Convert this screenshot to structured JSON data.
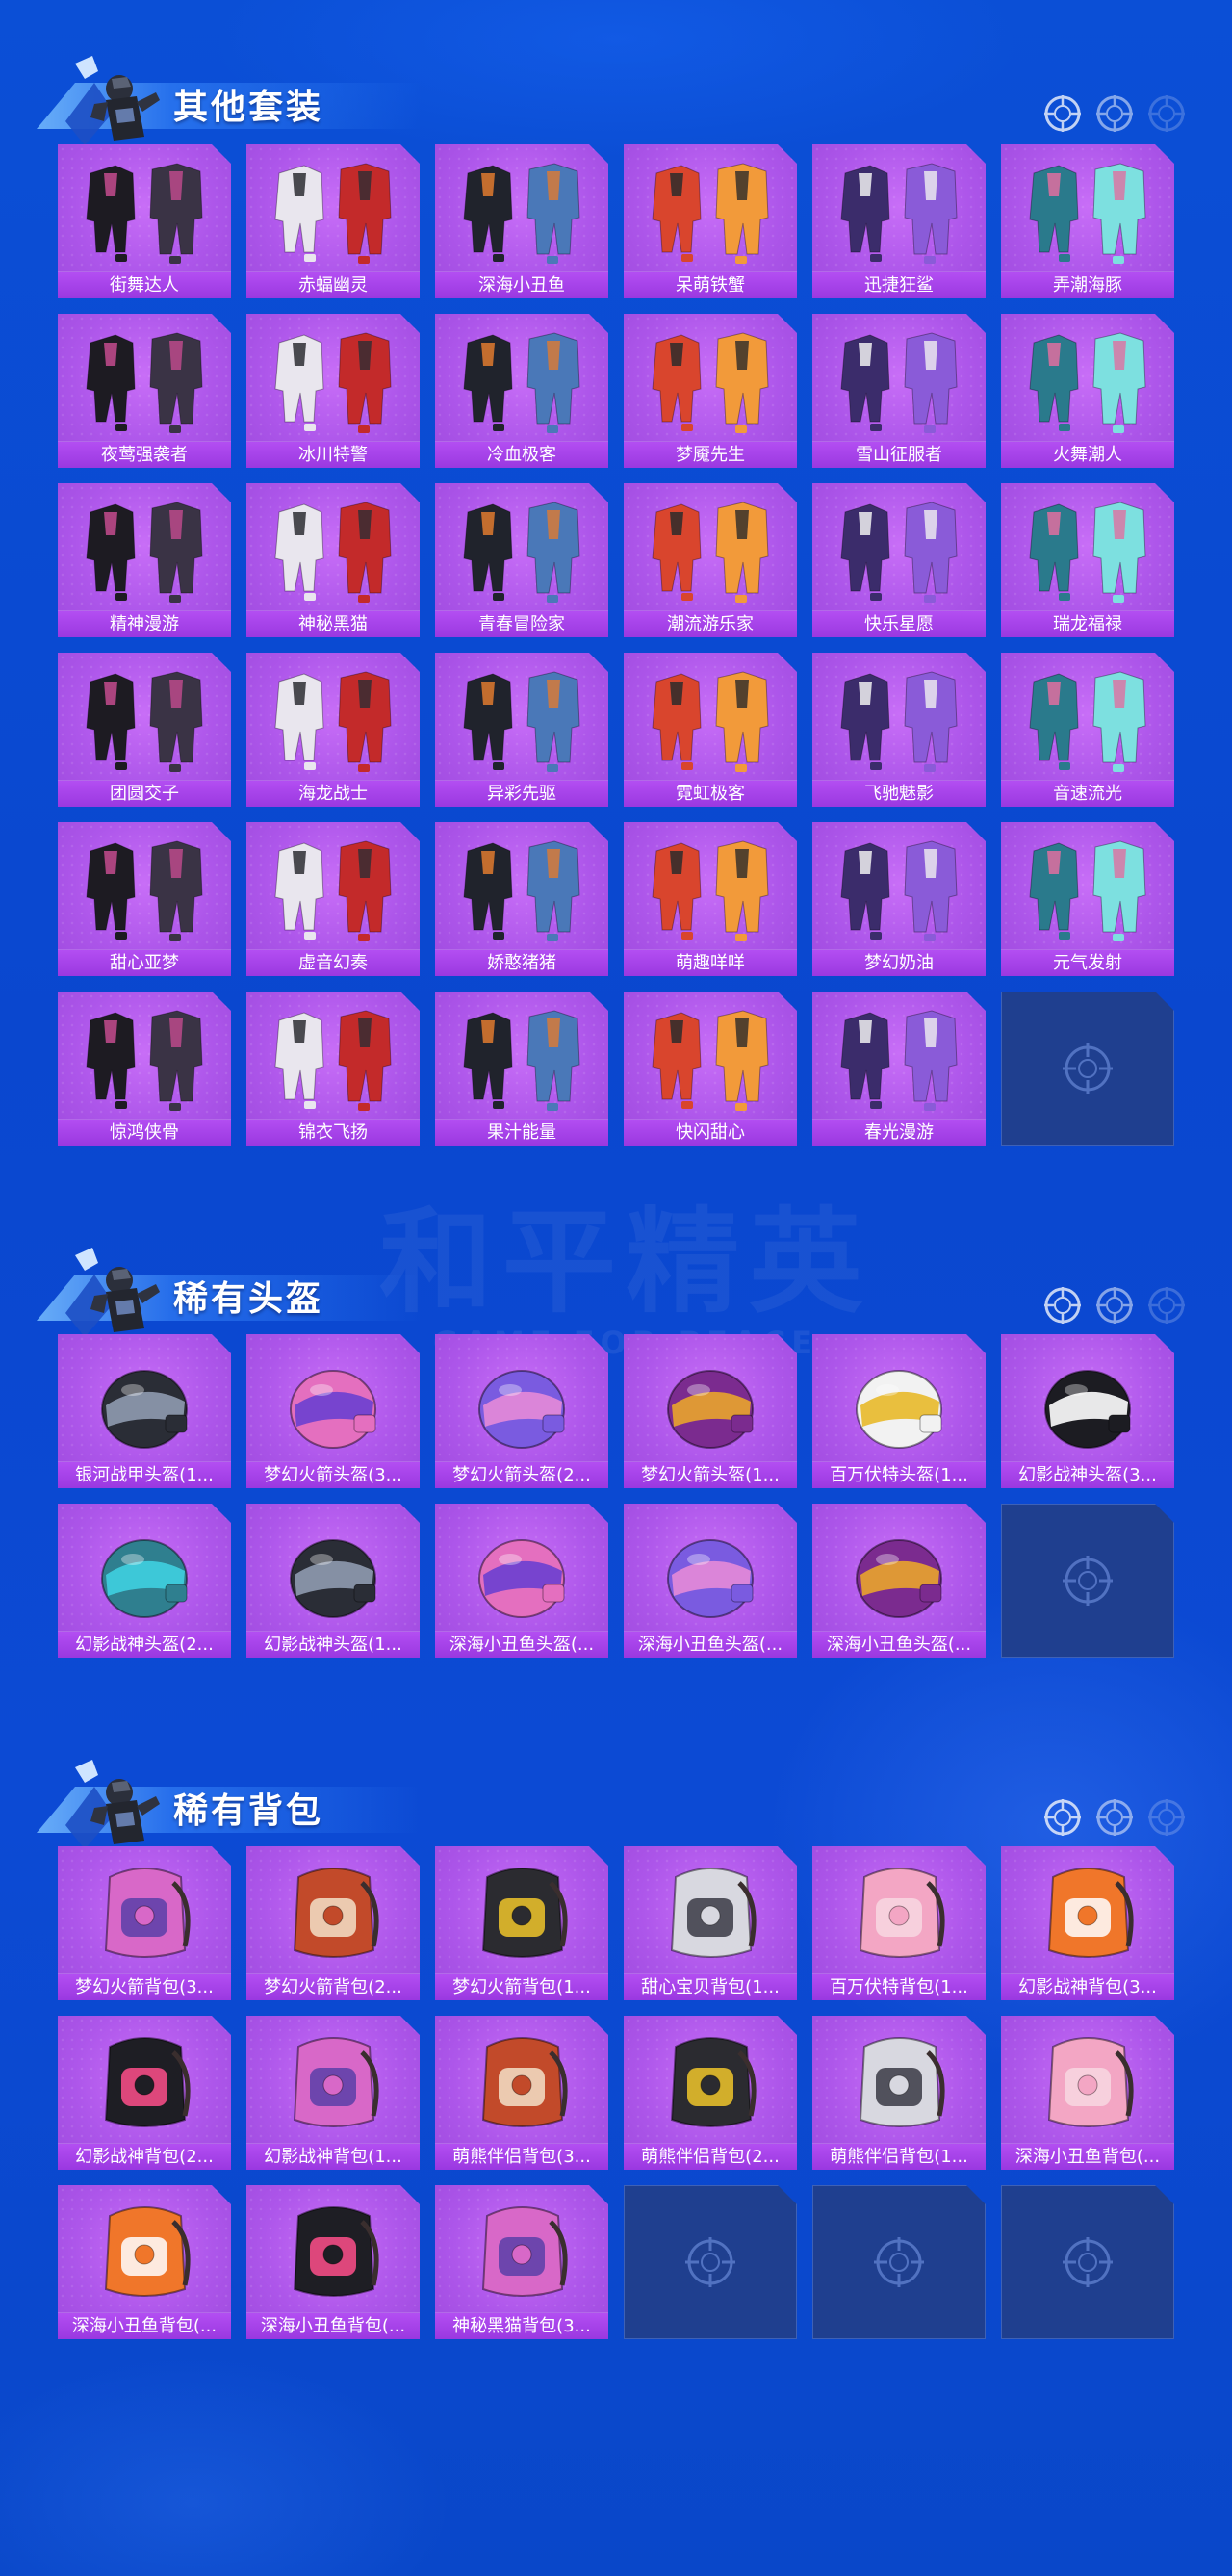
{
  "colors": {
    "page_background": "#0b4fd6",
    "card_purple": "#ad56ea",
    "label_bar": "#9a38e0",
    "empty_slot": "#1f3f8f"
  },
  "watermark": {
    "big": "和平精英",
    "small": "GAME FOR PEACE"
  },
  "sections": [
    {
      "title": "其他套装",
      "kind": "outfit",
      "items": [
        {
          "label": "街舞达人",
          "icon": "outfit-icon"
        },
        {
          "label": "赤蝠幽灵",
          "icon": "outfit-icon"
        },
        {
          "label": "深海小丑鱼",
          "icon": "outfit-icon"
        },
        {
          "label": "呆萌铁蟹",
          "icon": "outfit-icon"
        },
        {
          "label": "迅捷狂鲨",
          "icon": "outfit-icon"
        },
        {
          "label": "弄潮海豚",
          "icon": "outfit-icon"
        },
        {
          "label": "夜莺强袭者",
          "icon": "outfit-icon"
        },
        {
          "label": "冰川特警",
          "icon": "outfit-icon"
        },
        {
          "label": "冷血极客",
          "icon": "outfit-icon"
        },
        {
          "label": "梦魇先生",
          "icon": "outfit-icon"
        },
        {
          "label": "雪山征服者",
          "icon": "outfit-icon"
        },
        {
          "label": "火舞潮人",
          "icon": "outfit-icon"
        },
        {
          "label": "精神漫游",
          "icon": "outfit-icon"
        },
        {
          "label": "神秘黑猫",
          "icon": "outfit-icon"
        },
        {
          "label": "青春冒险家",
          "icon": "outfit-icon"
        },
        {
          "label": "潮流游乐家",
          "icon": "outfit-icon"
        },
        {
          "label": "快乐星愿",
          "icon": "outfit-icon"
        },
        {
          "label": "瑞龙福禄",
          "icon": "outfit-icon"
        },
        {
          "label": "团圆交子",
          "icon": "outfit-icon"
        },
        {
          "label": "海龙战士",
          "icon": "outfit-icon"
        },
        {
          "label": "异彩先驱",
          "icon": "outfit-icon"
        },
        {
          "label": "霓虹极客",
          "icon": "outfit-icon"
        },
        {
          "label": "飞驰魅影",
          "icon": "outfit-icon"
        },
        {
          "label": "音速流光",
          "icon": "outfit-icon"
        },
        {
          "label": "甜心亚梦",
          "icon": "outfit-icon"
        },
        {
          "label": "虚音幻奏",
          "icon": "outfit-icon"
        },
        {
          "label": "娇憨猪猪",
          "icon": "outfit-icon"
        },
        {
          "label": "萌趣咩咩",
          "icon": "outfit-icon"
        },
        {
          "label": "梦幻奶油",
          "icon": "outfit-icon"
        },
        {
          "label": "元气发射",
          "icon": "outfit-icon"
        },
        {
          "label": "惊鸿侠骨",
          "icon": "outfit-icon"
        },
        {
          "label": "锦衣飞扬",
          "icon": "outfit-icon"
        },
        {
          "label": "果汁能量",
          "icon": "outfit-icon"
        },
        {
          "label": "快闪甜心",
          "icon": "outfit-icon"
        },
        {
          "label": "春光漫游",
          "icon": "outfit-icon"
        }
      ],
      "empty_slots": 1
    },
    {
      "title": "稀有头盔",
      "kind": "helmet",
      "items": [
        {
          "label": "银河战甲头盔(1...",
          "icon": "helmet-icon"
        },
        {
          "label": "梦幻火箭头盔(3...",
          "icon": "helmet-icon"
        },
        {
          "label": "梦幻火箭头盔(2...",
          "icon": "helmet-icon"
        },
        {
          "label": "梦幻火箭头盔(1...",
          "icon": "helmet-icon"
        },
        {
          "label": "百万伏特头盔(1...",
          "icon": "helmet-icon"
        },
        {
          "label": "幻影战神头盔(3...",
          "icon": "helmet-icon"
        },
        {
          "label": "幻影战神头盔(2...",
          "icon": "helmet-icon"
        },
        {
          "label": "幻影战神头盔(1...",
          "icon": "helmet-icon"
        },
        {
          "label": "深海小丑鱼头盔(...",
          "icon": "helmet-icon"
        },
        {
          "label": "深海小丑鱼头盔(...",
          "icon": "helmet-icon"
        },
        {
          "label": "深海小丑鱼头盔(...",
          "icon": "helmet-icon"
        }
      ],
      "empty_slots": 1
    },
    {
      "title": "稀有背包",
      "kind": "backpack",
      "items": [
        {
          "label": "梦幻火箭背包(3...",
          "icon": "backpack-icon"
        },
        {
          "label": "梦幻火箭背包(2...",
          "icon": "backpack-icon"
        },
        {
          "label": "梦幻火箭背包(1...",
          "icon": "backpack-icon"
        },
        {
          "label": "甜心宝贝背包(1...",
          "icon": "backpack-icon"
        },
        {
          "label": "百万伏特背包(1...",
          "icon": "backpack-icon"
        },
        {
          "label": "幻影战神背包(3...",
          "icon": "backpack-icon"
        },
        {
          "label": "幻影战神背包(2...",
          "icon": "backpack-icon"
        },
        {
          "label": "幻影战神背包(1...",
          "icon": "backpack-icon"
        },
        {
          "label": "萌熊伴侣背包(3...",
          "icon": "backpack-icon"
        },
        {
          "label": "萌熊伴侣背包(2...",
          "icon": "backpack-icon"
        },
        {
          "label": "萌熊伴侣背包(1...",
          "icon": "backpack-icon"
        },
        {
          "label": "深海小丑鱼背包(...",
          "icon": "backpack-icon"
        },
        {
          "label": "深海小丑鱼背包(...",
          "icon": "backpack-icon"
        },
        {
          "label": "深海小丑鱼背包(...",
          "icon": "backpack-icon"
        },
        {
          "label": "神秘黑猫背包(3...",
          "icon": "backpack-icon"
        }
      ],
      "empty_slots": 3
    }
  ]
}
